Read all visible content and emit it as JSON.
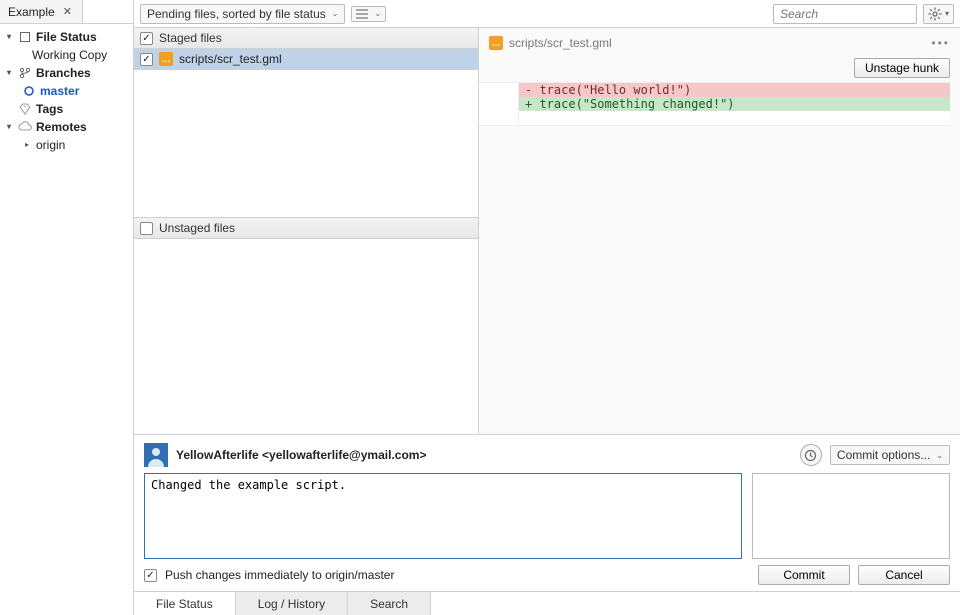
{
  "tab": {
    "title": "Example"
  },
  "sidebar": {
    "file_status": "File Status",
    "working_copy": "Working Copy",
    "branches": "Branches",
    "master": "master",
    "tags": "Tags",
    "remotes": "Remotes",
    "origin": "origin"
  },
  "toolbar": {
    "filter_label": "Pending files, sorted by file status",
    "search_placeholder": "Search"
  },
  "staged": {
    "header": "Staged files",
    "files": [
      {
        "path": "scripts/scr_test.gml"
      }
    ]
  },
  "unstaged": {
    "header": "Unstaged files"
  },
  "diff": {
    "file": "scripts/scr_test.gml",
    "unstage_label": "Unstage hunk",
    "lines": [
      {
        "type": "del",
        "text": "- trace(\"Hello world!\")"
      },
      {
        "type": "add",
        "text": "+ trace(\"Something changed!\")"
      }
    ]
  },
  "commit": {
    "author": "YellowAfterlife <yellowafterlife@ymail.com>",
    "options_label": "Commit options...",
    "message": "Changed the example script.",
    "push_label": "Push changes immediately to origin/master",
    "commit_btn": "Commit",
    "cancel_btn": "Cancel"
  },
  "bottom_tabs": {
    "file_status": "File Status",
    "log_history": "Log / History",
    "search": "Search"
  }
}
